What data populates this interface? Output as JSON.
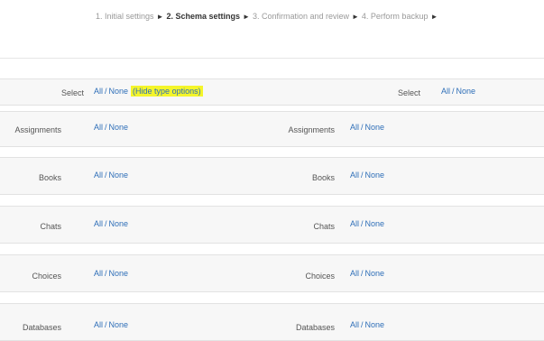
{
  "progress": {
    "step1": "1. Initial settings",
    "step2": "2. Schema settings",
    "step3": "3. Confirmation and review",
    "step4": "4. Perform backup",
    "arrow": "►"
  },
  "select_row": {
    "label": "Select",
    "all": "All",
    "none": "None",
    "hide_options": "(Hide type options)",
    "right_label": "Select",
    "right_all": "All",
    "right_none": "None"
  },
  "types": [
    {
      "label": "Assignments",
      "all": "All",
      "none": "None"
    },
    {
      "label": "Books",
      "all": "All",
      "none": "None"
    },
    {
      "label": "Chats",
      "all": "All",
      "none": "None"
    },
    {
      "label": "Choices",
      "all": "All",
      "none": "None"
    },
    {
      "label": "Databases",
      "all": "All",
      "none": "None"
    }
  ],
  "highlight_color": "#f4f52a",
  "link_color": "#2f6fb8"
}
